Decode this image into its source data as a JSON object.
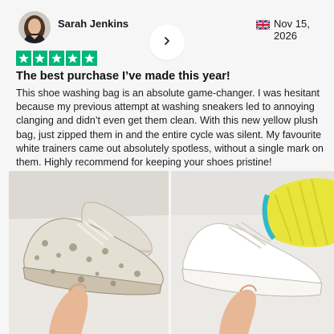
{
  "review": {
    "reviewer_name": "Sarah Jenkins",
    "country": "United Kingdom",
    "date": "Nov 15, 2026",
    "rating": 5,
    "title": "The best purchase I’ve made this year!",
    "body": "This shoe washing bag is an absolute game-changer. I was hesitant because my previous attempt at washing sneakers led to annoying clanging and didn’t even get them clean. With this new yellow plush bag, just zipped them in and the entire cycle was silent. My favourite white trainers came out absolutely spotless, without a single mark on them. Highly recommend for keeping your shoes pristine!"
  },
  "icons": {
    "flag": "uk-flag-icon",
    "next": "chevron-right-icon",
    "star": "star-icon"
  },
  "colors": {
    "star_background": "#00b67a",
    "star_glyph": "#ffffff",
    "bag": "#e9e43a",
    "bag_trim": "#2fb9c9"
  }
}
